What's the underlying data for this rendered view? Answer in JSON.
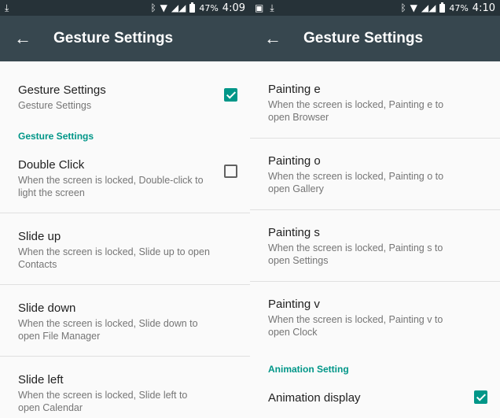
{
  "left": {
    "status": {
      "battery": "47%",
      "time": "4:09"
    },
    "appbar": {
      "title": "Gesture Settings"
    },
    "master": {
      "title": "Gesture Settings",
      "summary": "Gesture Settings",
      "checked": true
    },
    "category": "Gesture Settings",
    "items": [
      {
        "title": "Double Click",
        "summary": "When the screen is locked, Double-click to light the screen",
        "checked": false
      },
      {
        "title": "Slide up",
        "summary": "When the screen is locked, Slide up to open Contacts"
      },
      {
        "title": "Slide down",
        "summary": "When the screen is locked, Slide down to open File Manager"
      },
      {
        "title": "Slide left",
        "summary": "When the screen is locked, Slide left to open Calendar"
      }
    ]
  },
  "right": {
    "status": {
      "battery": "47%",
      "time": "4:10"
    },
    "appbar": {
      "title": "Gesture Settings"
    },
    "items": [
      {
        "title": "Painting e",
        "summary": "When the screen is locked, Painting e to open Browser"
      },
      {
        "title": "Painting o",
        "summary": "When the screen is locked, Painting o to open Gallery"
      },
      {
        "title": "Painting s",
        "summary": "When the screen is locked, Painting s to open Settings"
      },
      {
        "title": "Painting v",
        "summary": "When the screen is locked, Painting v to open Clock"
      }
    ],
    "category": "Animation Setting",
    "animation": {
      "title": "Animation display",
      "checked": true
    }
  },
  "colors": {
    "statusbar": "#263238",
    "appbar": "#37474f",
    "accent": "#009688",
    "background": "#fafafa"
  },
  "icons": [
    "download-icon",
    "bluetooth-icon",
    "wifi-icon",
    "signal-icon",
    "battery-icon",
    "image-icon",
    "back-arrow-icon",
    "checkbox-icon"
  ]
}
